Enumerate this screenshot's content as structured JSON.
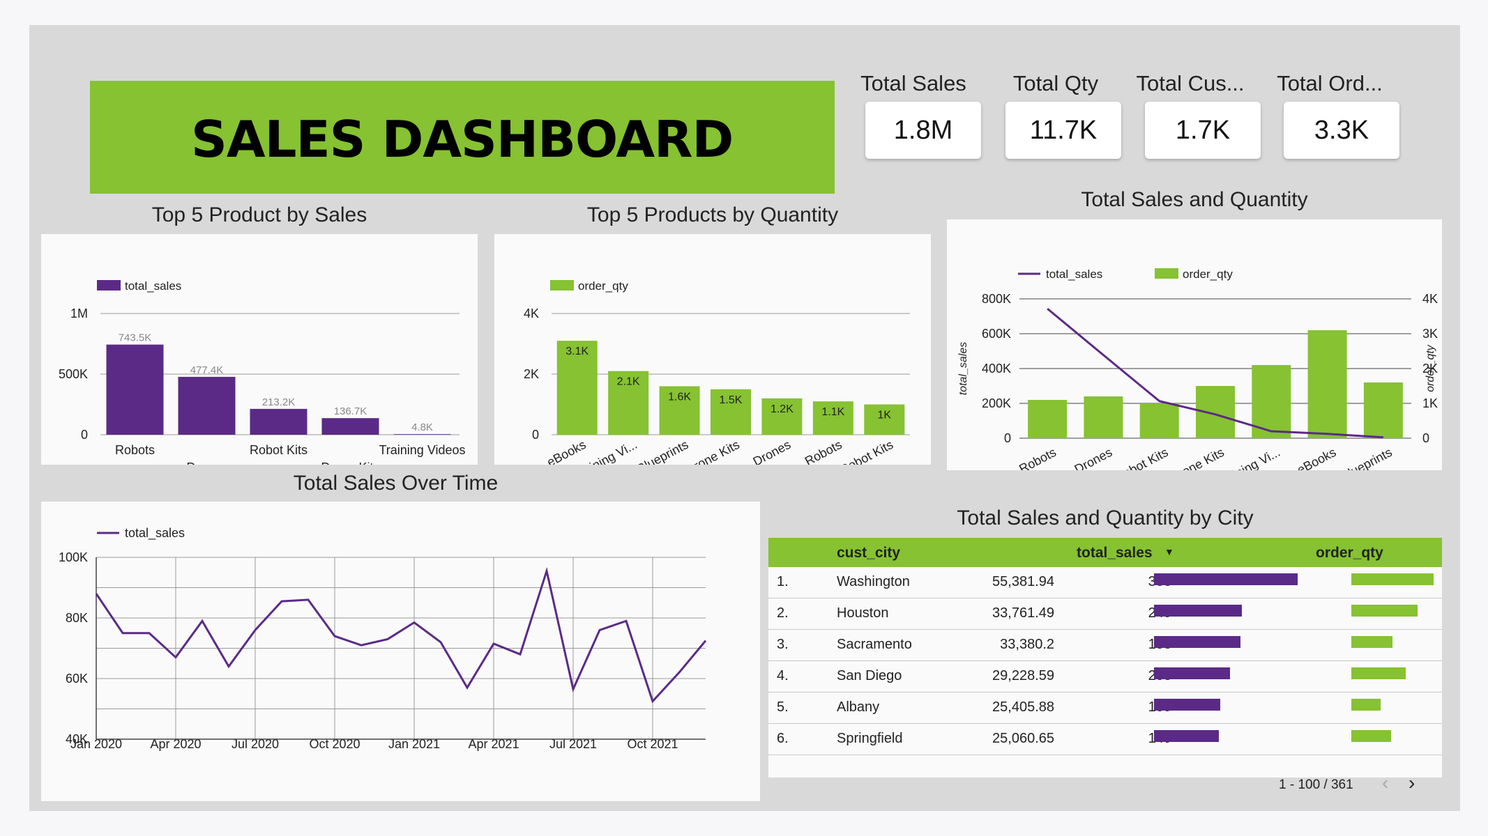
{
  "header": {
    "title": "SALES DASHBOARD"
  },
  "kpis": [
    {
      "label": "Total Sales",
      "value": "1.8M"
    },
    {
      "label": "Total Qty",
      "value": "11.7K"
    },
    {
      "label": "Total Cus...",
      "value": "1.7K"
    },
    {
      "label": "Total Ord...",
      "value": "3.3K"
    }
  ],
  "colors": {
    "green": "#86c232",
    "purple": "#5b2a86",
    "panel": "#fafafa",
    "canvas": "#d9d9d9"
  },
  "chart_data": [
    {
      "type": "bar",
      "title": "Top 5 Product by Sales",
      "legend": "total_sales",
      "legend_position": "top-left",
      "categories": [
        "Robots",
        "Drones",
        "Robot Kits",
        "Drone Kits",
        "Training Videos"
      ],
      "values": [
        743500,
        477400,
        213200,
        136700,
        4800
      ],
      "labels": [
        "743.5K",
        "477.4K",
        "213.2K",
        "136.7K",
        "4.8K"
      ],
      "yticks": [
        "0",
        "500K",
        "1M"
      ],
      "ylim": [
        0,
        1000000
      ],
      "grid": true
    },
    {
      "type": "bar",
      "title": "Top 5 Products by Quantity",
      "legend": "order_qty",
      "legend_position": "top-left",
      "categories": [
        "eBooks",
        "Training Vi...",
        "Blueprints",
        "Drone Kits",
        "Drones",
        "Robots",
        "Robot Kits"
      ],
      "values": [
        3100,
        2100,
        1600,
        1500,
        1200,
        1100,
        1000
      ],
      "labels": [
        "3.1K",
        "2.1K",
        "1.6K",
        "1.5K",
        "1.2K",
        "1.1K",
        "1K"
      ],
      "yticks": [
        "0",
        "2K",
        "4K"
      ],
      "ylim": [
        0,
        4000
      ],
      "grid": true
    },
    {
      "type": "bar",
      "title": "Total Sales and Quantity",
      "legend_position": "top-left",
      "categories": [
        "Robots",
        "Drones",
        "Robot Kits",
        "Drone Kits",
        "Training Vi...",
        "eBooks",
        "Blueprints"
      ],
      "series": [
        {
          "name": "total_sales",
          "type": "line",
          "axis": "left",
          "values": [
            743500,
            477400,
            213200,
            136700,
            40000,
            25000,
            4800
          ]
        },
        {
          "name": "order_qty",
          "type": "bar",
          "axis": "right",
          "values": [
            1100,
            1200,
            1000,
            1500,
            2100,
            3100,
            1600
          ]
        }
      ],
      "ylabel": "total_sales",
      "ylabel_right": "order_qty",
      "yticks": [
        "0",
        "200K",
        "400K",
        "600K",
        "800K"
      ],
      "yticks_right": [
        "0",
        "1K",
        "2K",
        "3K",
        "4K"
      ],
      "ylim": [
        0,
        800000
      ],
      "ylim_right": [
        0,
        4000
      ],
      "grid": true
    },
    {
      "type": "line",
      "title": "Total Sales Over Time",
      "legend": "total_sales",
      "legend_position": "top-left",
      "x_start": "Jan 2020",
      "x_end": "Nov 2021",
      "xticks": [
        "Jan 2020",
        "Apr 2020",
        "Jul 2020",
        "Oct 2020",
        "Jan 2021",
        "Apr 2021",
        "Jul 2021",
        "Oct 2021"
      ],
      "yticks": [
        "40K",
        "60K",
        "80K",
        "100K"
      ],
      "ylim": [
        40000,
        100000
      ],
      "values": [
        88000,
        75000,
        75000,
        67000,
        79000,
        64000,
        76000,
        85500,
        86000,
        74000,
        71000,
        73000,
        78500,
        72000,
        57000,
        71500,
        68000,
        95500,
        56500,
        76000,
        79000,
        52500,
        62000,
        72500
      ],
      "grid": true
    },
    {
      "type": "table",
      "title": "Total Sales and Quantity by City",
      "columns": [
        "cust_city",
        "total_sales",
        "order_qty"
      ],
      "sort_column": "total_sales",
      "rows": [
        {
          "rank": "1.",
          "city": "Washington",
          "sales": "55,381.94",
          "sales_value": 55381.94,
          "qty": "308",
          "qty_value": 308
        },
        {
          "rank": "2.",
          "city": "Houston",
          "sales": "33,761.49",
          "sales_value": 33761.49,
          "qty": "249",
          "qty_value": 249
        },
        {
          "rank": "3.",
          "city": "Sacramento",
          "sales": "33,380.2",
          "sales_value": 33380.2,
          "qty": "153",
          "qty_value": 153
        },
        {
          "rank": "4.",
          "city": "San Diego",
          "sales": "29,228.59",
          "sales_value": 29228.59,
          "qty": "203",
          "qty_value": 203
        },
        {
          "rank": "5.",
          "city": "Albany",
          "sales": "25,405.88",
          "sales_value": 25405.88,
          "qty": "109",
          "qty_value": 109
        },
        {
          "rank": "6.",
          "city": "Springfield",
          "sales": "25,060.65",
          "sales_value": 25060.65,
          "qty": "149",
          "qty_value": 149
        }
      ],
      "pagination": "1 - 100 / 361"
    }
  ]
}
